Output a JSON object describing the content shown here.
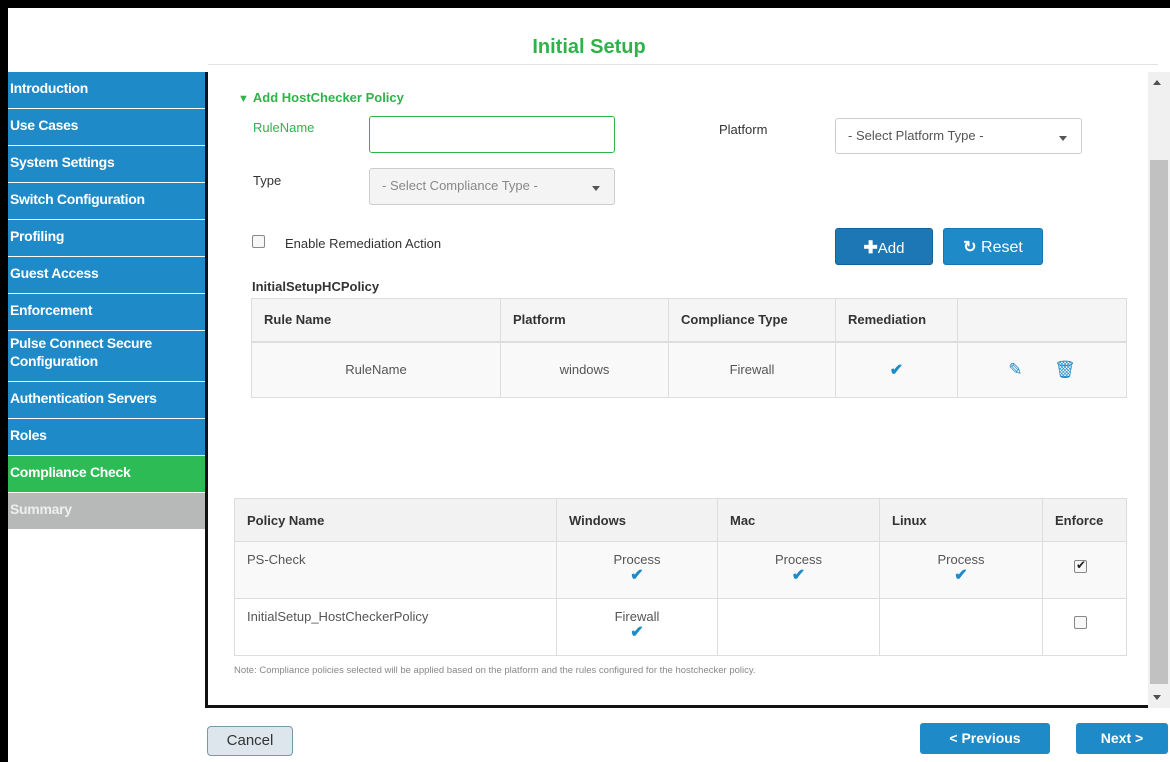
{
  "page_title": "Initial Setup",
  "sidebar": {
    "items": [
      {
        "label": "Introduction",
        "state": "normal"
      },
      {
        "label": "Use Cases",
        "state": "normal"
      },
      {
        "label": "System Settings",
        "state": "normal"
      },
      {
        "label": "Switch Configuration",
        "state": "normal"
      },
      {
        "label": "Profiling",
        "state": "normal"
      },
      {
        "label": "Guest Access",
        "state": "normal"
      },
      {
        "label": "Enforcement",
        "state": "normal"
      },
      {
        "label": "Pulse Connect Secure Configuration",
        "state": "normal"
      },
      {
        "label": "Authentication Servers",
        "state": "normal"
      },
      {
        "label": "Roles",
        "state": "normal"
      },
      {
        "label": "Compliance Check",
        "state": "active"
      },
      {
        "label": "Summary",
        "state": "disabled"
      }
    ]
  },
  "form": {
    "section_title": "Add HostChecker Policy",
    "rule_name_label": "RuleName",
    "rule_name_value": "",
    "platform_label": "Platform",
    "platform_select": "- Select Platform Type -",
    "type_label": "Type",
    "type_select": "- Select Compliance Type -",
    "remediation_label": "Enable Remediation Action",
    "remediation_checked": false,
    "add_label": "Add",
    "reset_label": "Reset"
  },
  "hc_policy": {
    "title": "InitialSetupHCPolicy",
    "headers": [
      "Rule Name",
      "Platform",
      "Compliance Type",
      "Remediation",
      ""
    ],
    "rows": [
      {
        "rule_name": "RuleName",
        "platform": "windows",
        "compliance_type": "Firewall",
        "remediation": true
      }
    ]
  },
  "policies": {
    "headers": [
      "Policy Name",
      "Windows",
      "Mac",
      "Linux",
      "Enforce"
    ],
    "rows": [
      {
        "name": "PS-Check",
        "windows": "Process",
        "mac": "Process",
        "linux": "Process",
        "enforce": true
      },
      {
        "name": "InitialSetup_HostCheckerPolicy",
        "windows": "Firewall",
        "mac": "",
        "linux": "",
        "enforce": false
      }
    ]
  },
  "note": "Note: Compliance policies selected will be applied based on the platform and the rules configured for the hostchecker policy.",
  "footer": {
    "cancel_label": "Cancel",
    "previous_label": "< Previous",
    "next_label": "Next >"
  },
  "colors": {
    "accent_green": "#2eb34a",
    "nav_blue": "#1e8ac8",
    "active_green": "#2dbb56",
    "disabled_gray": "#b7b9b9"
  },
  "icons": {
    "section_toggle": "chevron-down-icon",
    "add": "plus-icon",
    "reset": "refresh-icon",
    "edit": "pencil-icon",
    "delete": "trash-icon",
    "check": "checkmark-icon"
  }
}
